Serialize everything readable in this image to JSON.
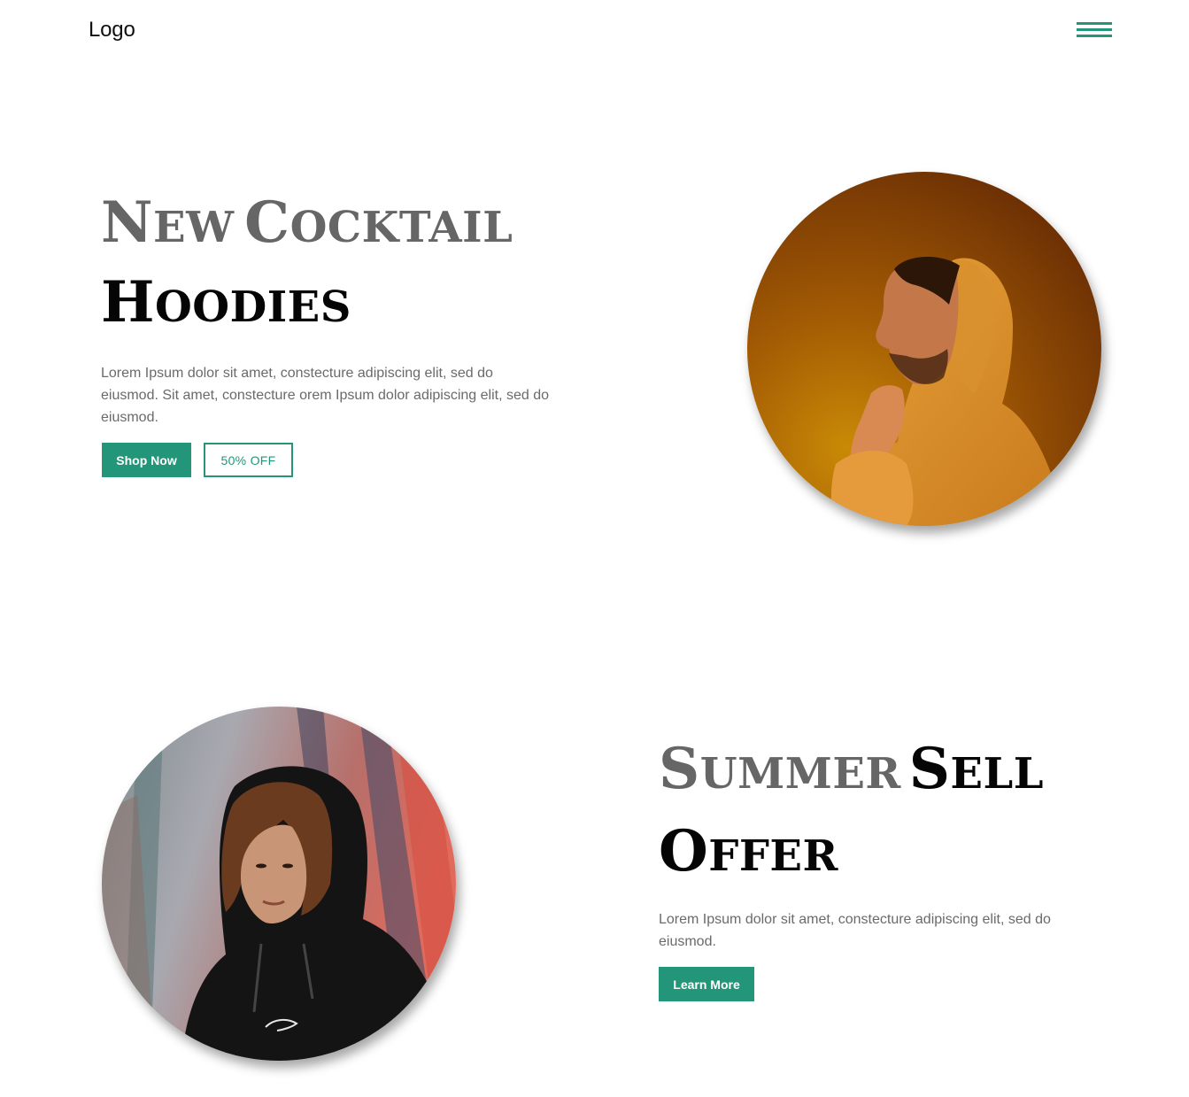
{
  "header": {
    "logo_text": "Logo",
    "menu_icon": "hamburger-menu-icon",
    "accent_color": "#23967a"
  },
  "hero": {
    "heading_line1_word1": {
      "cap": "N",
      "rest": "EW"
    },
    "heading_line1_word2": {
      "cap": "C",
      "rest": "OCKTAIL"
    },
    "heading_line2_word1": {
      "cap": "H",
      "rest": "OODIES"
    },
    "description": "Lorem Ipsum dolor sit amet, constecture adipiscing elit, sed do eiusmod. Sit amet, constecture orem Ipsum dolor adipiscing elit, sed do eiusmod.",
    "primary_button": "Shop Now",
    "secondary_button": "50% OFF"
  },
  "offer": {
    "heading_line1_word1": {
      "cap": "S",
      "rest": "UMMER"
    },
    "heading_line1_word2": {
      "cap": "S",
      "rest": "ELL"
    },
    "heading_line2_word1": {
      "cap": "O",
      "rest": "FFER"
    },
    "description": "Lorem Ipsum dolor sit amet, constecture adipiscing elit, sed do eiusmod.",
    "button": "Learn More"
  },
  "colors": {
    "accent": "#23967a",
    "heading_grey": "#666666",
    "heading_black": "#050505",
    "body_text": "#6a6a6a"
  }
}
